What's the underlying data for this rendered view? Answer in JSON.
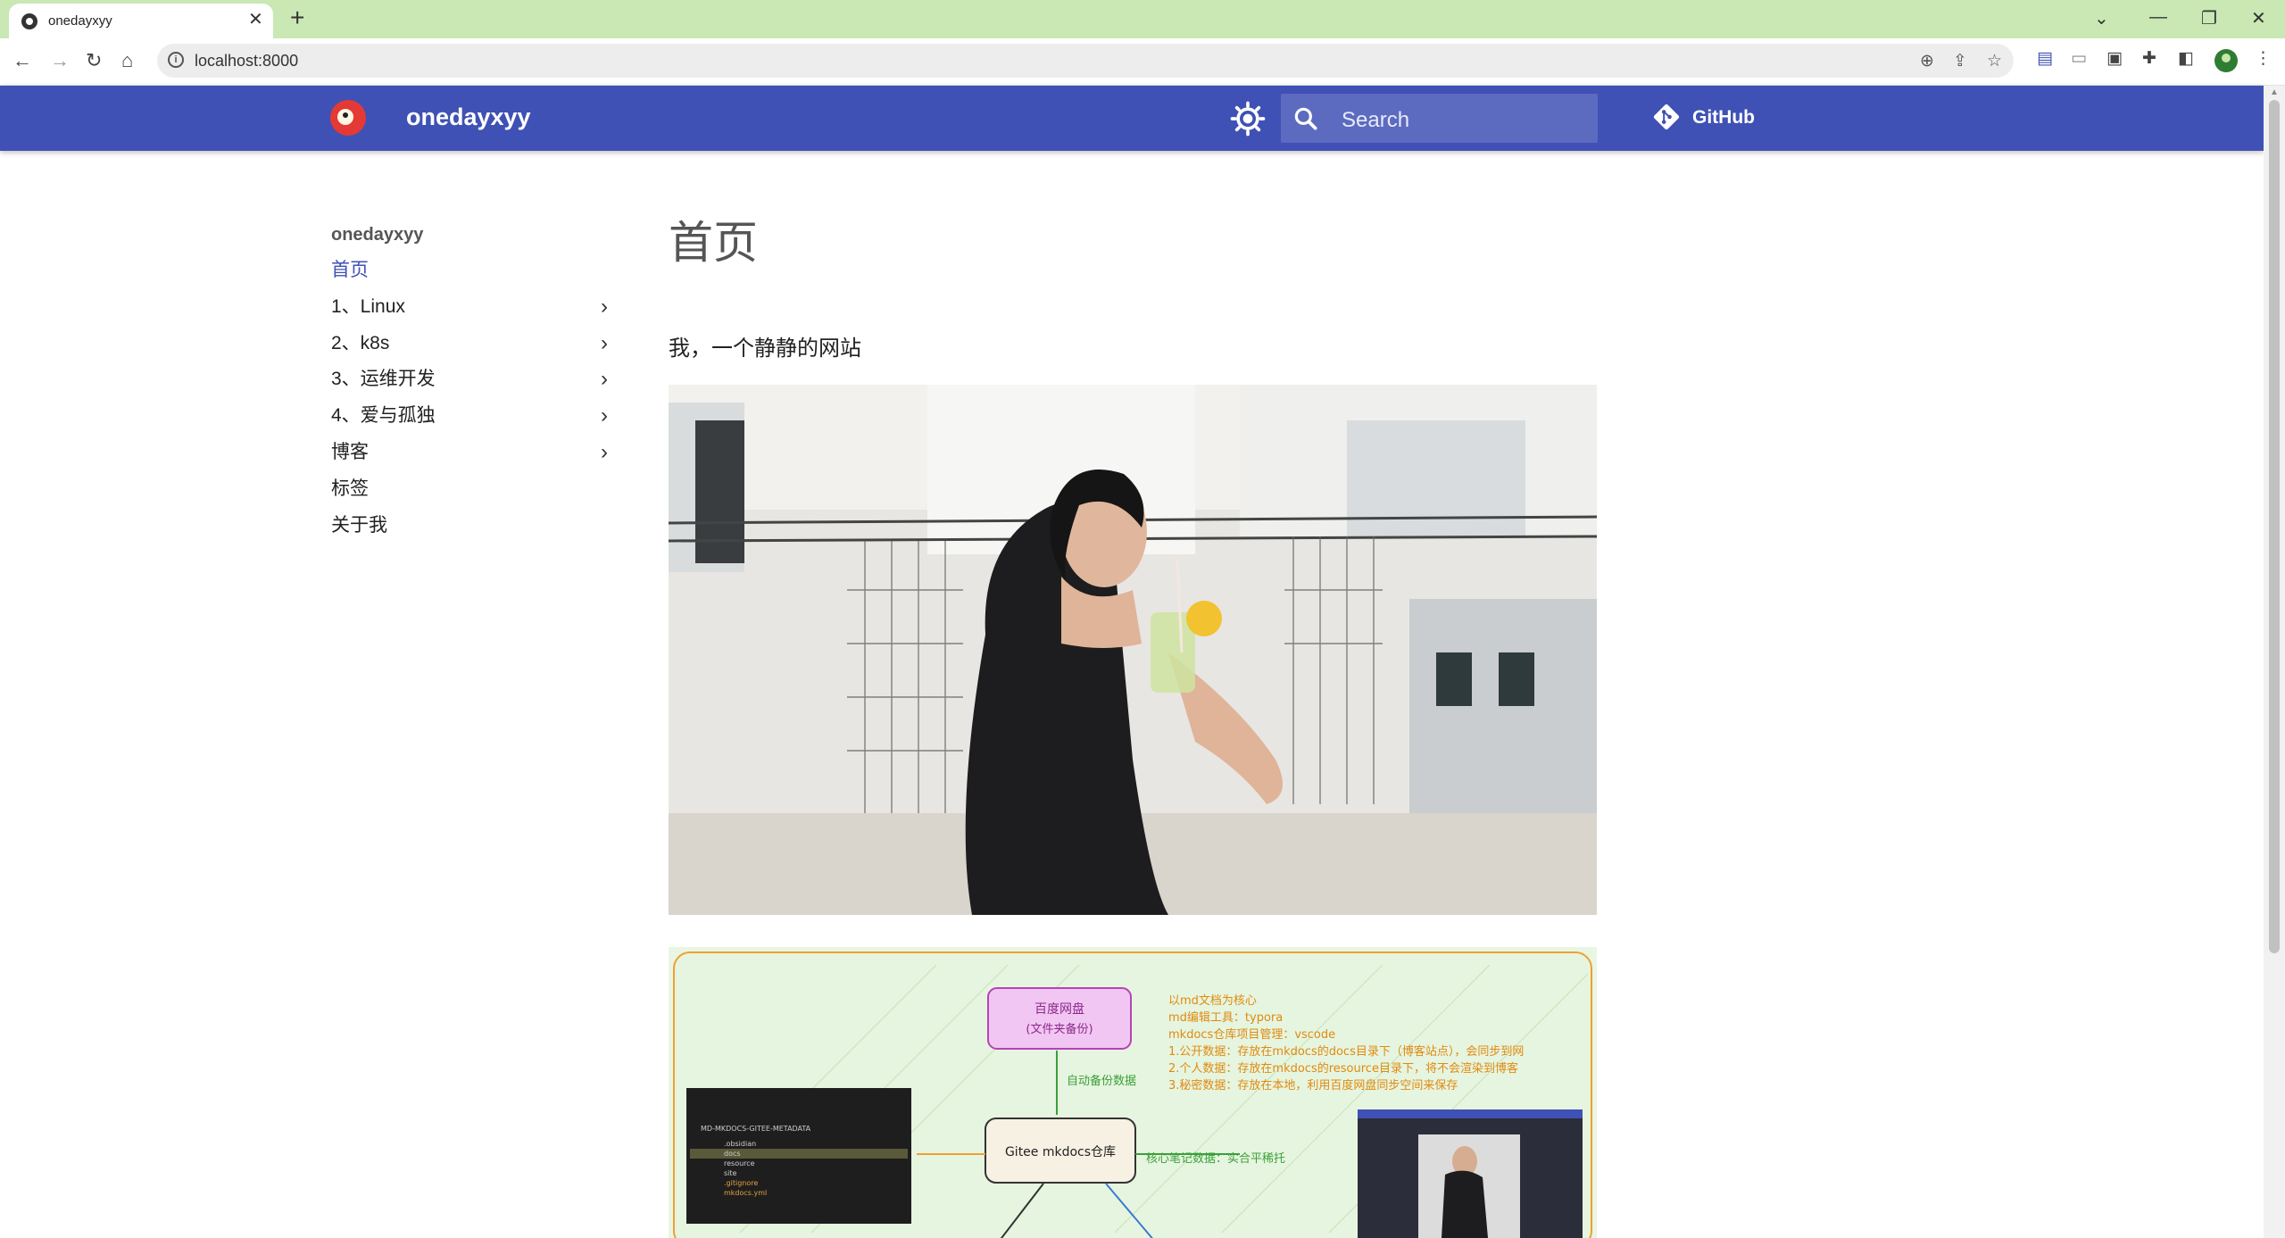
{
  "browser": {
    "tab_title": "onedayxyy",
    "url": "localhost:8000"
  },
  "site": {
    "title": "onedayxyy",
    "search_placeholder": "Search",
    "github_label": "GitHub"
  },
  "sidebar": {
    "heading": "onedayxyy",
    "items": [
      {
        "label": "首页",
        "active": true,
        "expandable": false
      },
      {
        "label": "1、Linux",
        "active": false,
        "expandable": true
      },
      {
        "label": "2、k8s",
        "active": false,
        "expandable": true
      },
      {
        "label": "3、运维开发",
        "active": false,
        "expandable": true
      },
      {
        "label": "4、爱与孤独",
        "active": false,
        "expandable": true
      },
      {
        "label": "博客",
        "active": false,
        "expandable": true
      },
      {
        "label": "标签",
        "active": false,
        "expandable": false
      },
      {
        "label": "关于我",
        "active": false,
        "expandable": false
      }
    ]
  },
  "content": {
    "title": "首页",
    "intro": "我，一个静静的网站"
  },
  "diagram": {
    "node_top_line1": "百度网盘",
    "node_top_line2": "(文件夹备份)",
    "edge_top_label": "自动备份数据",
    "node_center": "Gitee mkdocs仓库",
    "edge_right_label": "核心笔记数据：实合平稀托",
    "notes": [
      "以md文档为核心",
      "md编辑工具：typora",
      "mkdocs仓库项目管理：vscode",
      "1.公开数据：存放在mkdocs的docs目录下（博客站点），会同步到网",
      "2.个人数据：存放在mkdocs的resource目录下，将不会渲染到博客",
      "3.秘密数据：存放在本地，利用百度网盘同步空间来保存"
    ],
    "vscode_header": "MD-MKDOCS-GITEE-METADATA",
    "vscode_files": [
      ".obsidian",
      "docs",
      "resource",
      "site",
      ".gitignore",
      "mkdocs.yml"
    ]
  },
  "colors": {
    "header": "#3f51b5",
    "accent": "#3f51b5",
    "tabstrip": "#c9e8b4"
  }
}
